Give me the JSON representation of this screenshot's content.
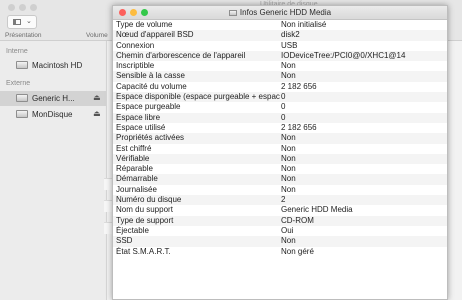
{
  "bg_window": {
    "title": "Utilitaire de disque",
    "toolbar": {
      "presentation_label": "Présentation",
      "volume_label": "Volume"
    },
    "sidebar": {
      "sections": [
        {
          "title": "Interne",
          "items": [
            {
              "label": "Macintosh HD"
            }
          ]
        },
        {
          "title": "Externe",
          "items": [
            {
              "label": "Generic H...",
              "selected": true,
              "eject": "⏏"
            },
            {
              "label": "MonDisque",
              "eject": "⏏"
            }
          ]
        }
      ]
    }
  },
  "info_window": {
    "title": "Infos Generic HDD Media",
    "rows": [
      {
        "key": "Type de volume",
        "value": "Non initialisé"
      },
      {
        "key": "Nœud d'appareil BSD",
        "value": "disk2"
      },
      {
        "key": "Connexion",
        "value": "USB"
      },
      {
        "key": "Chemin d'arborescence de l'appareil",
        "value": "IODeviceTree:/PCI0@0/XHC1@14"
      },
      {
        "key": "Inscriptible",
        "value": "Non"
      },
      {
        "key": "Sensible à la casse",
        "value": "Non"
      },
      {
        "key": "Capacité du volume",
        "value": "2 182 656"
      },
      {
        "key": "Espace disponible (espace purgeable + espace libre)",
        "value": "0"
      },
      {
        "key": "Espace purgeable",
        "value": "0"
      },
      {
        "key": "Espace libre",
        "value": "0"
      },
      {
        "key": "Espace utilisé",
        "value": "2 182 656"
      },
      {
        "key": "Propriétés activées",
        "value": "Non"
      },
      {
        "key": "Est chiffré",
        "value": "Non"
      },
      {
        "key": "Vérifiable",
        "value": "Non"
      },
      {
        "key": "Réparable",
        "value": "Non"
      },
      {
        "key": "Démarrable",
        "value": "Non"
      },
      {
        "key": "Journalisée",
        "value": "Non"
      },
      {
        "key": "Numéro du disque",
        "value": "2"
      },
      {
        "key": "Nom du support",
        "value": "Generic HDD Media"
      },
      {
        "key": "Type de support",
        "value": "CD-ROM"
      },
      {
        "key": "Éjectable",
        "value": "Oui"
      },
      {
        "key": "SSD",
        "value": "Non"
      },
      {
        "key": "État S.M.A.R.T.",
        "value": "Non géré"
      }
    ]
  },
  "colors": {
    "close": "#fc605c",
    "minimize": "#fdbc40",
    "zoom": "#34c84a",
    "inactive": "#cfcfcf"
  }
}
